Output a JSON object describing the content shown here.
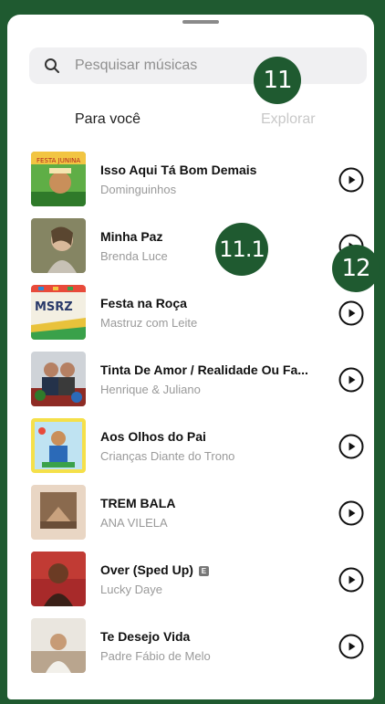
{
  "search": {
    "placeholder": "Pesquisar músicas"
  },
  "tabs": {
    "for_you": "Para você",
    "explore": "Explorar"
  },
  "badges": {
    "b1": "11",
    "b2": "11.1",
    "b3": "12"
  },
  "colors": {
    "frame": "#1f5a30",
    "badge": "#1f5a30",
    "muted_text": "#9a9a9a"
  },
  "songs": [
    {
      "title": "Isso Aqui Tá Bom Demais",
      "artist": "Dominguinhos",
      "cover_text": "FESTA JUNINA",
      "explicit": false
    },
    {
      "title": "Minha Paz",
      "artist": "Brenda Luce",
      "explicit": false
    },
    {
      "title": "Festa na Roça",
      "artist": "Mastruz com Leite",
      "cover_text": "MSRZ",
      "explicit": false
    },
    {
      "title": "Tinta De Amor / Realidade Ou Fa...",
      "artist": "Henrique & Juliano",
      "explicit": false
    },
    {
      "title": "Aos Olhos do Pai",
      "artist": "Crianças Diante do Trono",
      "explicit": false
    },
    {
      "title": "TREM BALA",
      "artist": "ANA VILELA",
      "explicit": false
    },
    {
      "title": "Over (Sped Up)",
      "artist": "Lucky Daye",
      "explicit": true,
      "explicit_label": "E"
    },
    {
      "title": "Te Desejo Vida",
      "artist": "Padre Fábio de Melo",
      "explicit": false
    }
  ]
}
